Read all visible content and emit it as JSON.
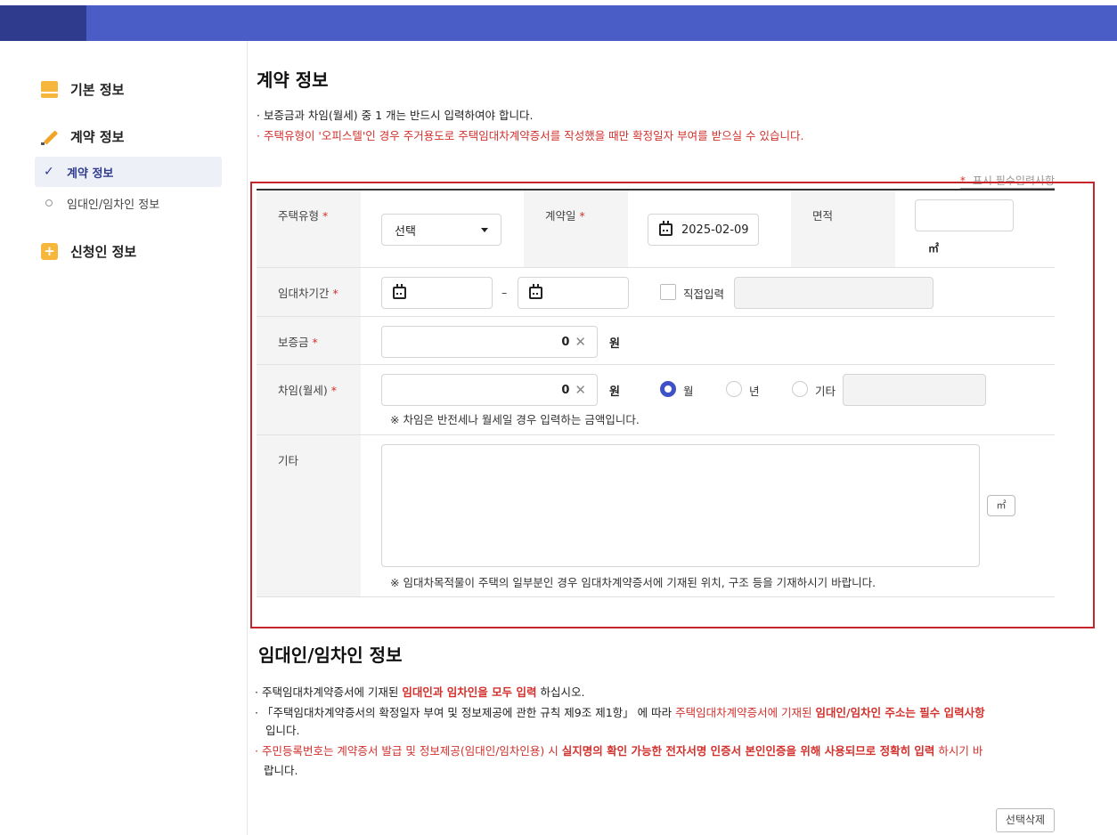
{
  "sidebar": {
    "groups": [
      {
        "label": "기본 정보",
        "icon": "document-icon"
      },
      {
        "label": "계약 정보",
        "icon": "pencil-icon"
      },
      {
        "label": "신청인 정보",
        "icon": "plus-icon"
      }
    ],
    "sub_items": [
      {
        "label": "계약 정보",
        "active": true
      },
      {
        "label": "임대인/임차인 정보",
        "active": false
      }
    ]
  },
  "contract": {
    "title": "계약 정보",
    "notes": [
      "· 보증금과 차임(월세) 중 1 개는 반드시 입력하여야 합니다.",
      "· 주택유형이 '오피스텔'인 경우 주거용도로 주택임대차계약증서를 작성했을 때만 확정일자 부여를 받으실 수 있습니다."
    ],
    "required_legend": "표시 필수입력사항",
    "form": {
      "housing_type_label": "주택유형",
      "housing_type_value": "선택",
      "contract_date_label": "계약일",
      "contract_date_value": "2025-02-09",
      "area_label": "면적",
      "area_unit": "㎡",
      "lease_period_label": "임대차기간",
      "period_separator": "–",
      "direct_input_label": "직접입력",
      "deposit_label": "보증금",
      "deposit_value": "0",
      "currency_unit": "원",
      "rent_label": "차임(월세)",
      "rent_value": "0",
      "rent_options": [
        "월",
        "년",
        "기타"
      ],
      "rent_selected": "월",
      "rent_hint": "※ 차임은 반전세나 월세일 경우 입력하는 금액입니다.",
      "etc_label": "기타",
      "etc_hint": "※ 임대차목적물이 주택의 일부분인 경우 임대차계약증서에 기재된 위치, 구조 등을 기재하시기 바랍니다.",
      "m2_button": "㎡",
      "clear_symbol": "✕"
    }
  },
  "parties": {
    "title": "임대인/임차인 정보",
    "note1": {
      "a": "· 주택임대차계약증서에 기재된 ",
      "b": "임대인과 임차인을 모두 입력",
      "c": " 하십시오."
    },
    "note2": {
      "a": "· 「주택임대차계약증서의 확정일자 부여 및 정보제공에 관한 규칙 제9조 제1항」 에 따라 ",
      "b": "주택임대차계약증서에 기재된 ",
      "c": " 임대인/임차인 주소는 필수 입력사항",
      "d": "입니다."
    },
    "note3": {
      "a": "· 주민등록번호는 계약증서 발급 및 정보제공(임대인/임차인용) 시 ",
      "b": " 실지명의 확인 가능한 전자서명 인증서 본인인증을 위해 사용되므로 정확히 입력",
      "c": " 하시기 바",
      "d": "랍니다."
    },
    "delete_button": "선택삭제"
  }
}
